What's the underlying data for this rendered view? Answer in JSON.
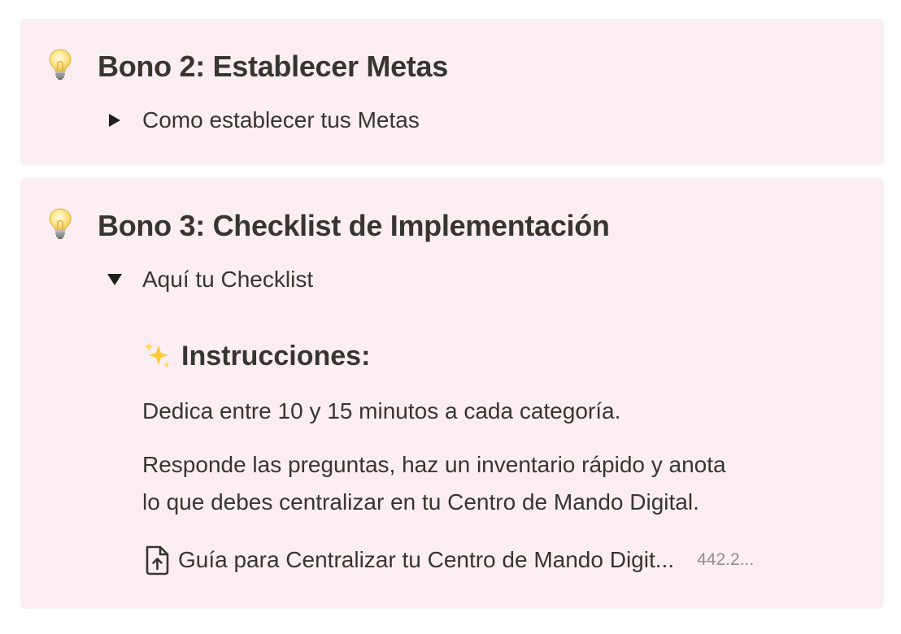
{
  "callouts": [
    {
      "icon": "lightbulb-icon",
      "title": "Bono 2: Establecer Metas",
      "toggle": {
        "label": "Como establecer tus Metas",
        "expanded": false
      }
    },
    {
      "icon": "lightbulb-icon",
      "title": "Bono 3: Checklist de Implementación",
      "toggle": {
        "label": "Aquí tu Checklist",
        "expanded": true
      },
      "content": {
        "heading_icon": "sparkles-icon",
        "heading": "Instrucciones:",
        "paragraph_1": "Dedica entre 10 y 15 minutos a cada categoría.",
        "paragraph_2_line_1": "Responde las preguntas, haz un inventario rápido y anota",
        "paragraph_2_line_2": "lo que debes centralizar en tu Centro de Mando Digital.",
        "file": {
          "icon": "file-upload-icon",
          "name": "Guía para Centralizar tu Centro de Mando Digit...",
          "size": "442.2..."
        }
      }
    }
  ],
  "colors": {
    "callout_background": "#fbeef3",
    "text": "#37352f",
    "muted_text": "#8f8e8a"
  }
}
